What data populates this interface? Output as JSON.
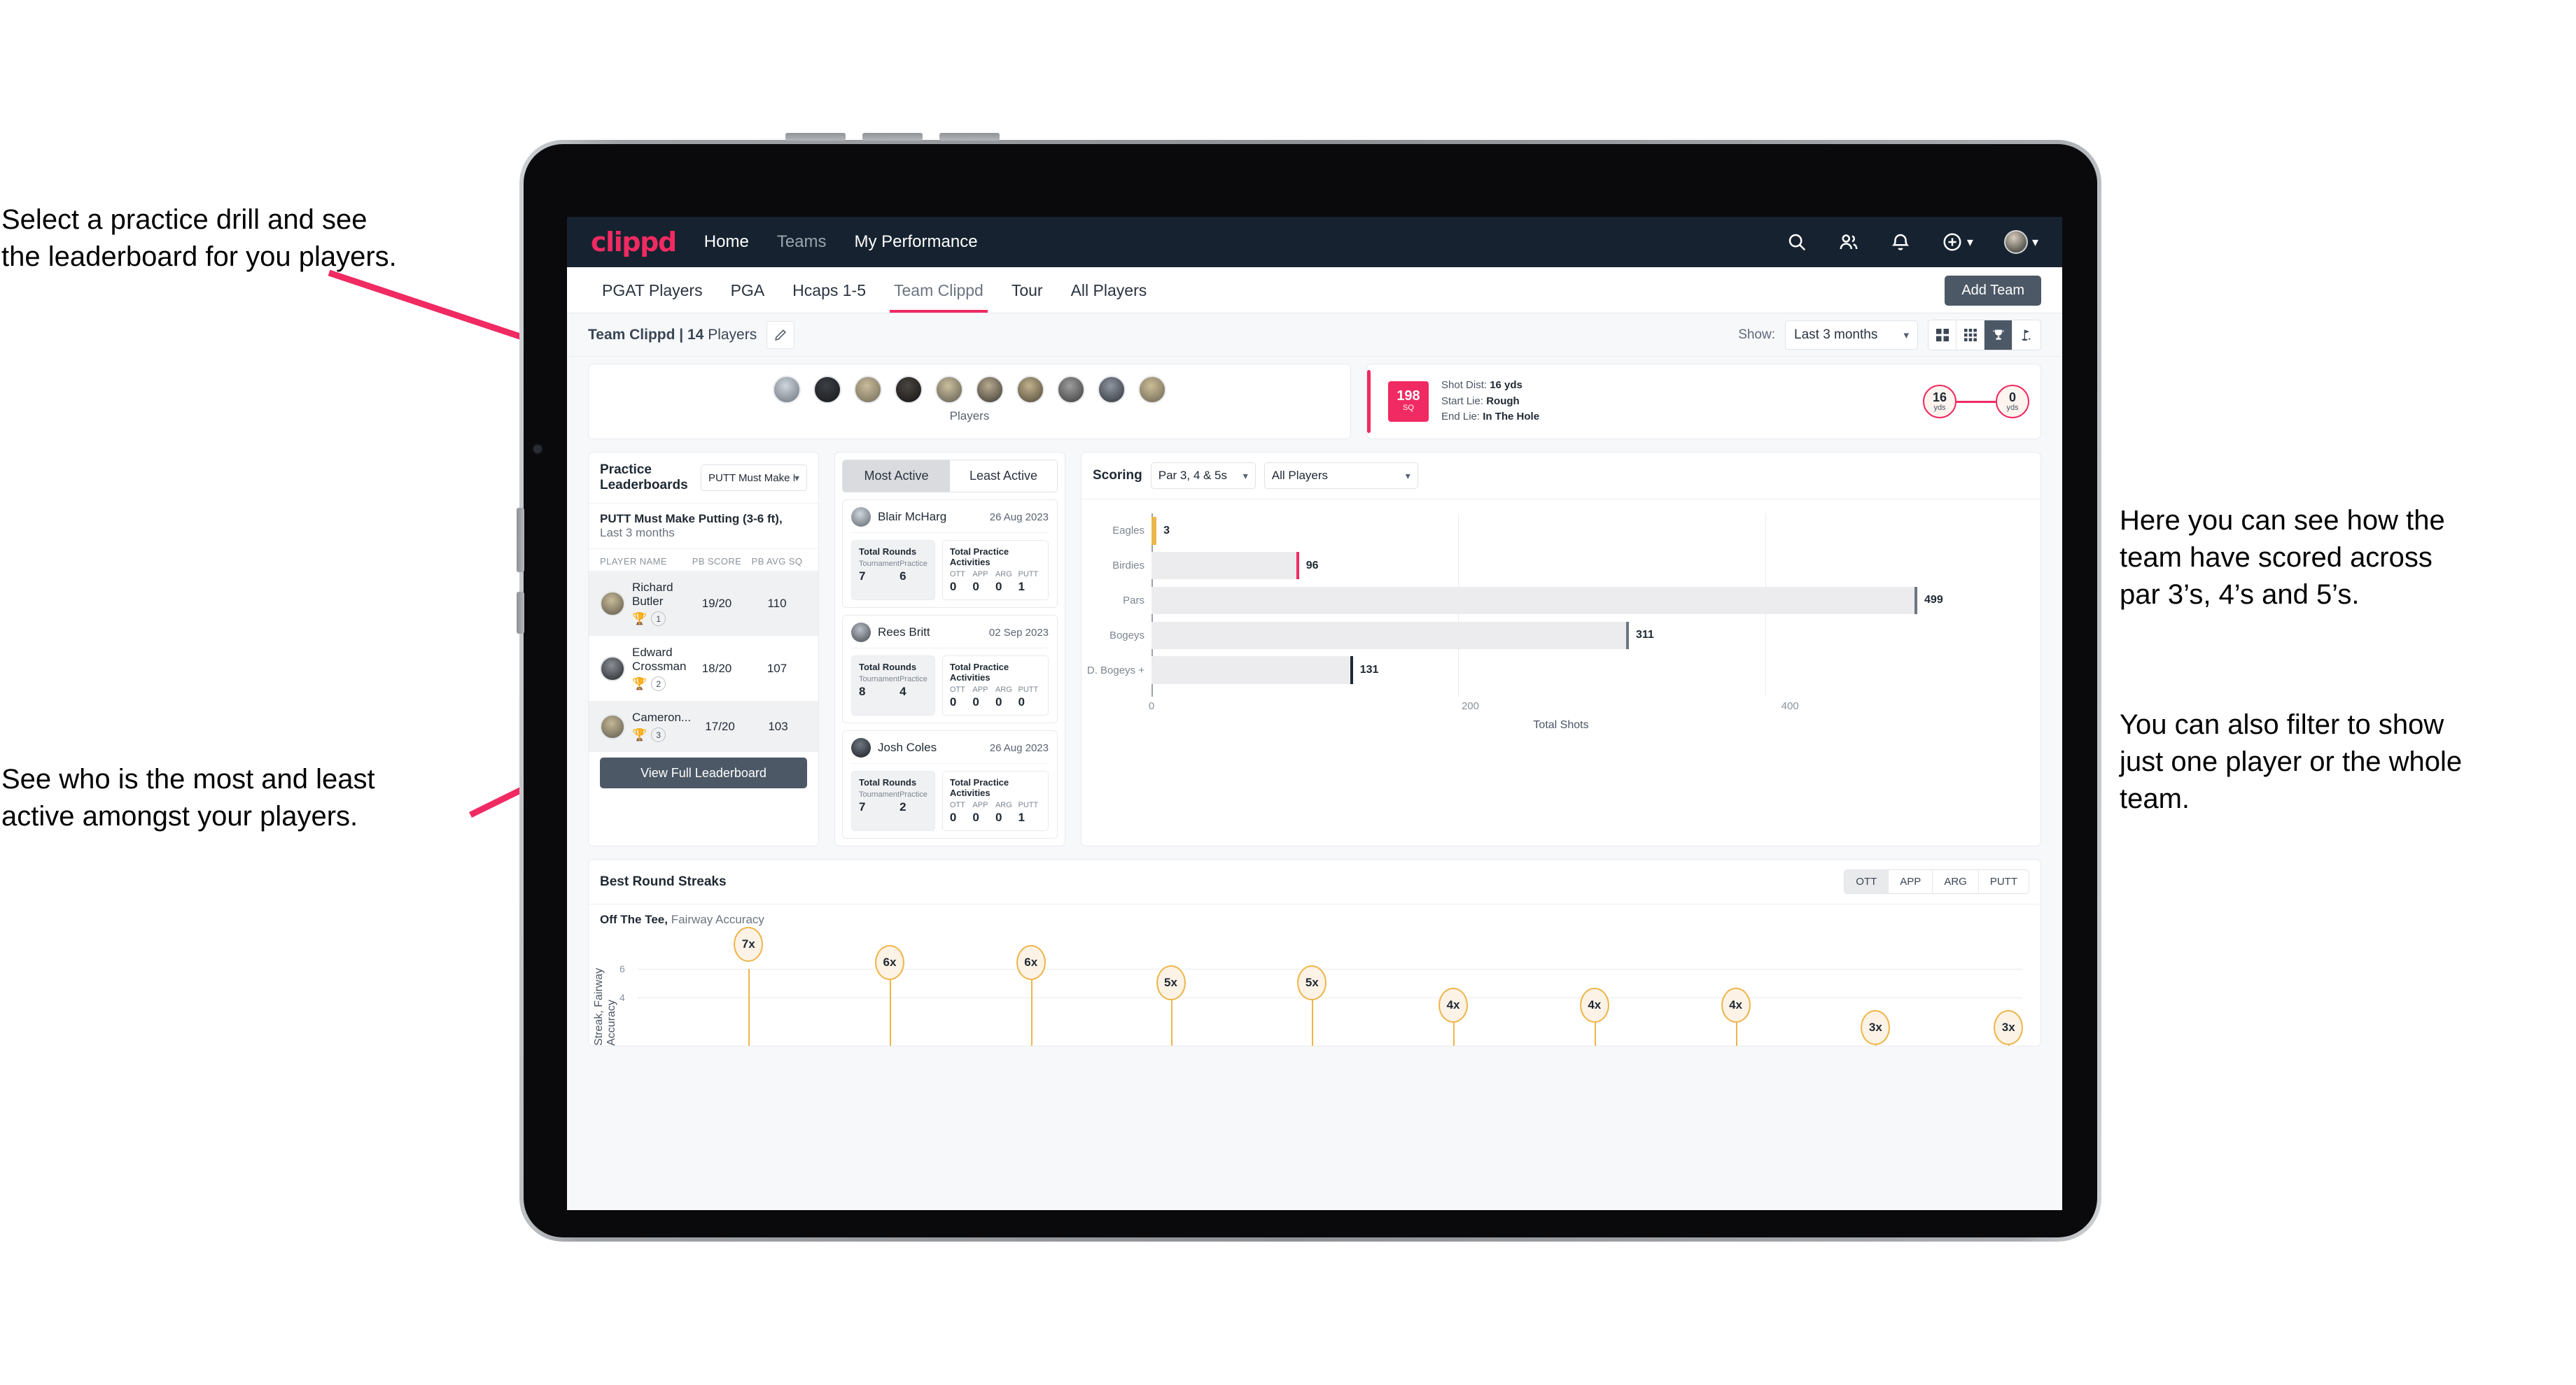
{
  "annotations": {
    "left_top": "Select a practice drill and see\nthe leaderboard for you players.",
    "left_bottom": "See who is the most and least\nactive amongst your players.",
    "right_top": "Here you can see how the\nteam have scored across\npar 3’s, 4’s and 5’s.",
    "right_bottom": "You can also filter to show\njust one player or the whole\nteam."
  },
  "navbar": {
    "logo": "clippd",
    "links": [
      {
        "label": "Home",
        "dim": false
      },
      {
        "label": "Teams",
        "dim": true
      },
      {
        "label": "My Performance",
        "dim": false
      }
    ],
    "icons": [
      "search-icon",
      "people-icon",
      "bell-icon",
      "plus-circle-icon",
      "avatar"
    ]
  },
  "subnav": {
    "tabs": [
      {
        "label": "PGAT Players",
        "active": false
      },
      {
        "label": "PGA",
        "active": false
      },
      {
        "label": "Hcaps 1-5",
        "active": false
      },
      {
        "label": "Team Clippd",
        "active": true
      },
      {
        "label": "Tour",
        "active": false
      },
      {
        "label": "All Players",
        "active": false
      }
    ],
    "add_team": "Add Team"
  },
  "toolbar": {
    "team_name": "Team Clippd | 14",
    "team_suffix": " Players",
    "edit_icon": "pencil-icon",
    "show_label": "Show:",
    "show_value": "Last 3 months",
    "views": [
      {
        "name": "grid-large-icon",
        "active": false
      },
      {
        "name": "grid-small-icon",
        "active": false
      },
      {
        "name": "trophy-icon",
        "active": true
      },
      {
        "name": "golf-flag-icon",
        "active": false
      }
    ]
  },
  "players_card": {
    "caption": "Players",
    "avatar_count": 10
  },
  "shot_card": {
    "sq_value": "198",
    "sq_label": "SQ",
    "lines": [
      {
        "label": "Shot Dist: ",
        "value": "16 yds"
      },
      {
        "label": "Start Lie: ",
        "value": "Rough"
      },
      {
        "label": "End Lie: ",
        "value": "In The Hole"
      }
    ],
    "start_ball": {
      "value": "16",
      "unit": "yds"
    },
    "end_ball": {
      "value": "0",
      "unit": "yds"
    }
  },
  "leaderboard": {
    "title": "Practice Leaderboards",
    "drill_select": "PUTT Must Make Putting ...",
    "subtitle_bold": "PUTT Must Make Putting (3-6 ft),",
    "subtitle_rest": " Last 3 months",
    "columns": [
      "PLAYER NAME",
      "PB SCORE",
      "PB AVG SQ"
    ],
    "rows": [
      {
        "name": "Richard Butler",
        "trophy": "gold",
        "rank": "1",
        "pb_score": "19/20",
        "pb_avg_sq": "110",
        "highlight": true
      },
      {
        "name": "Edward Crossman",
        "trophy": "silver",
        "rank": "2",
        "pb_score": "18/20",
        "pb_avg_sq": "107",
        "highlight": false
      },
      {
        "name": "Cameron...",
        "trophy": "bronze",
        "rank": "3",
        "pb_score": "17/20",
        "pb_avg_sq": "103",
        "highlight": true
      }
    ],
    "view_full_button": "View Full Leaderboard"
  },
  "activity": {
    "tabs": [
      {
        "label": "Most Active",
        "active": true
      },
      {
        "label": "Least Active",
        "active": false
      }
    ],
    "rounds_title": "Total Rounds",
    "rounds_cols": [
      "Tournament",
      "Practice"
    ],
    "practice_title": "Total Practice Activities",
    "practice_cols": [
      "OTT",
      "APP",
      "ARG",
      "PUTT"
    ],
    "items": [
      {
        "name": "Blair McHarg",
        "date": "26 Aug 2023",
        "tournament": "7",
        "practice": "6",
        "ott": "0",
        "app": "0",
        "arg": "0",
        "putt": "1"
      },
      {
        "name": "Rees Britt",
        "date": "02 Sep 2023",
        "tournament": "8",
        "practice": "4",
        "ott": "0",
        "app": "0",
        "arg": "0",
        "putt": "0"
      },
      {
        "name": "Josh Coles",
        "date": "26 Aug 2023",
        "tournament": "7",
        "practice": "2",
        "ott": "0",
        "app": "0",
        "arg": "0",
        "putt": "1"
      }
    ]
  },
  "scoring": {
    "title": "Scoring",
    "par_select": "Par 3, 4 & 5s",
    "player_select": "All Players"
  },
  "streaks": {
    "title": "Best Round Streaks",
    "toggle": [
      {
        "label": "OTT",
        "active": true
      },
      {
        "label": "APP",
        "active": false
      },
      {
        "label": "ARG",
        "active": false
      },
      {
        "label": "PUTT",
        "active": false
      }
    ],
    "sub_bold": "Off The Tee,",
    "sub_rest": " Fairway Accuracy"
  },
  "chart_data": [
    {
      "type": "bar",
      "orientation": "horizontal",
      "title": "Scoring",
      "categories": [
        "Eagles",
        "Birdies",
        "Pars",
        "Bogeys",
        "D. Bogeys +"
      ],
      "values": [
        3,
        96,
        499,
        311,
        131
      ],
      "bar_cap_colors": [
        "#edb64a",
        "#f02a62",
        "#6d7681",
        "#6d7681",
        "#1f2933"
      ],
      "xlabel": "Total Shots",
      "ylabel": "",
      "xticks": [
        0,
        200,
        400
      ],
      "xlim": [
        0,
        540
      ],
      "grid": true,
      "legend": "none"
    },
    {
      "type": "bar",
      "variant": "lollipop",
      "title": "Best Round Streaks",
      "subtitle": "Off The Tee, Fairway Accuracy",
      "ylabel": "Streak, Fairway Accuracy",
      "yticks": [
        4,
        6
      ],
      "ylim": [
        0,
        7.8
      ],
      "labels": [
        "7x",
        "6x",
        "6x",
        "5x",
        "5x",
        "4x",
        "4x",
        "4x",
        "3x",
        "3x"
      ],
      "values": [
        7,
        6,
        6,
        5,
        5,
        4,
        4,
        4,
        3,
        3
      ],
      "marker_fill": "#fdf2e6",
      "marker_stroke": "#edb64a",
      "grid": true
    }
  ],
  "colors": {
    "brand_pink": "#f02a62",
    "navy": "#16222f",
    "slate": "#4c5866",
    "amber": "#edb64a"
  }
}
